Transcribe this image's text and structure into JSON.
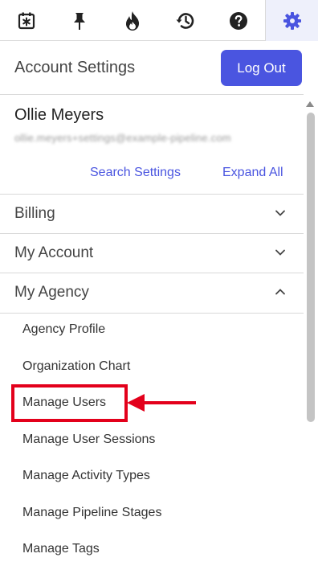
{
  "toolbar": {
    "icons": [
      "calendar-star-icon",
      "pin-icon",
      "flame-icon",
      "history-icon",
      "help-icon",
      "gear-icon"
    ],
    "active_tab": "gear-icon",
    "accent": "#4a55e0"
  },
  "header": {
    "title": "Account Settings",
    "logout_label": "Log Out"
  },
  "user": {
    "name": "Ollie Meyers",
    "email": "ollie.meyers+settings@example-pipeline.com"
  },
  "actions": {
    "search_settings": "Search Settings",
    "expand_all": "Expand All"
  },
  "sections": [
    {
      "label": "Billing",
      "expanded": false
    },
    {
      "label": "My Account",
      "expanded": false
    },
    {
      "label": "My Agency",
      "expanded": true
    }
  ],
  "agency_items": [
    "Agency Profile",
    "Organization Chart",
    "Manage Users",
    "Manage User Sessions",
    "Manage Activity Types",
    "Manage Pipeline Stages",
    "Manage Tags"
  ],
  "annotation": {
    "highlighted_item": "Manage Users",
    "color": "#e3001b"
  }
}
